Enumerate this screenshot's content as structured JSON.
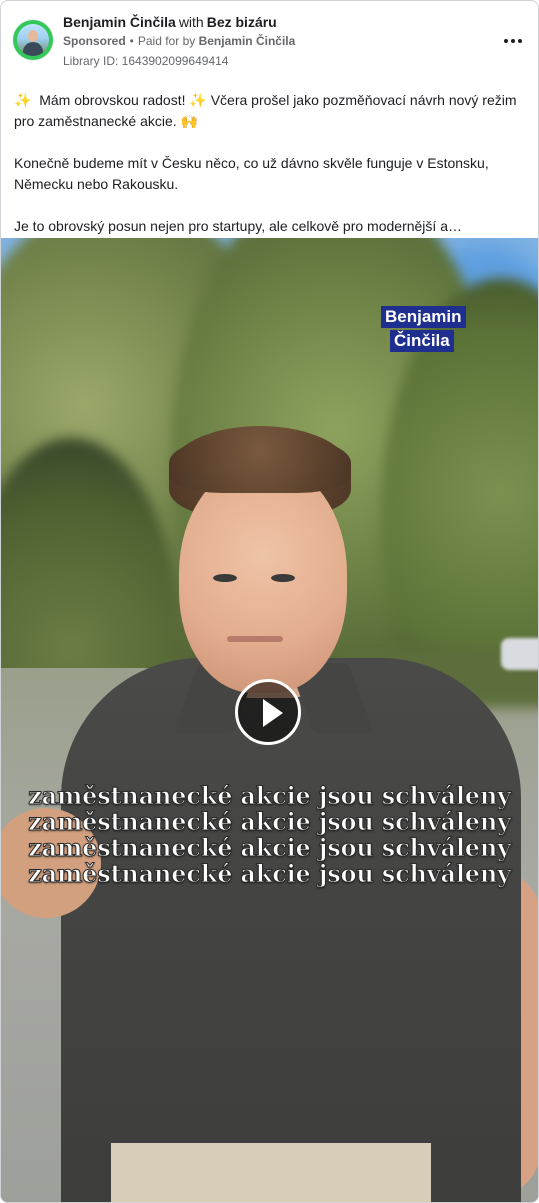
{
  "header": {
    "author": "Benjamin Činčila",
    "with_text": "with",
    "coauthor": "Bez bizáru",
    "sponsored": "Sponsored",
    "paid_prefix": "Paid for by",
    "paid_by": "Benjamin Činčila",
    "library_id": "Library ID: 1643902099649414",
    "more_icon": "more-horizontal-icon"
  },
  "post": {
    "p1": "Mám obrovskou radost! ✨ Včera prošel jako pozměňovací návrh nový režim pro zaměstnanecké akcie. 🙌",
    "p1_lead_emoji": "✨",
    "p2": "Konečně budeme mít v Česku něco, co už dávno skvěle funguje v Estonsku, Německu nebo Rakousku.",
    "p3": "Je to obrovský posun nejen pro startupy, ale celkově pro modernější a…"
  },
  "video": {
    "brand_line1": "Benjamin",
    "brand_line2": "Činčila",
    "caption_lines": [
      "zaměstnanecké akcie jsou schváleny",
      "zaměstnanecké akcie jsou schváleny",
      "zaměstnanecké akcie jsou schváleny",
      "zaměstnanecké akcie jsou schváleny"
    ],
    "play_icon": "play-icon"
  }
}
